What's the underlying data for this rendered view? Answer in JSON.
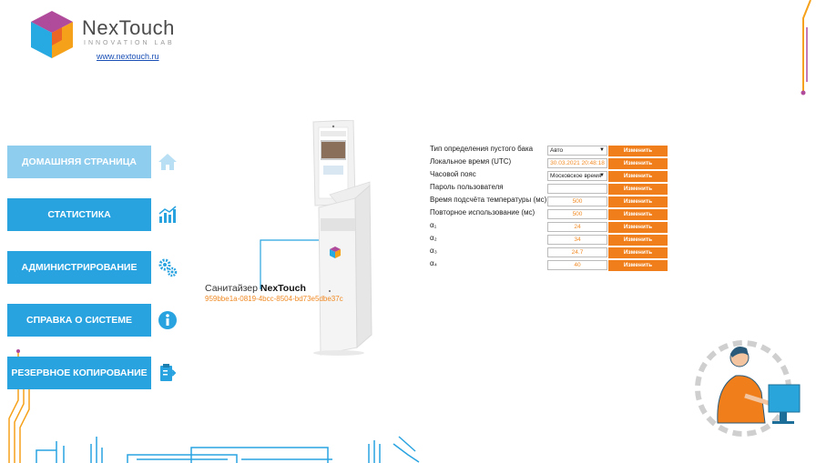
{
  "logo": {
    "brand": "NexTouch",
    "subtitle": "INNOVATION LAB",
    "url": "www.nextouch.ru"
  },
  "nav": {
    "items": [
      {
        "label": "ДОМАШНЯЯ СТРАНИЦА",
        "icon": "home-icon",
        "active": true
      },
      {
        "label": "СТАТИСТИКА",
        "icon": "stats-chart-icon",
        "active": false
      },
      {
        "label": "АДМИНИСТРИРОВАНИЕ",
        "icon": "gears-icon",
        "active": false
      },
      {
        "label": "СПРАВКА О СИСТЕМЕ",
        "icon": "info-icon",
        "active": false
      },
      {
        "label": "РЕЗЕРВНОЕ КОПИРОВАНИЕ",
        "icon": "backup-clipboard-icon",
        "active": false
      }
    ]
  },
  "device": {
    "caption_prefix": "Санитайзер ",
    "caption_brand": "NexTouch",
    "id": "959bbe1a-0819-4bcc-8504-bd73e5dbe37c"
  },
  "settings": {
    "rows": [
      {
        "label": "Тип определения пустого бака",
        "value": "Авто",
        "type": "select",
        "button": "Изменить"
      },
      {
        "label": "Локальное время (UTC)",
        "value": "30.03.2021 20:48:18",
        "type": "text",
        "button": "Изменить"
      },
      {
        "label": "Часовой пояс",
        "value": "Московское время",
        "type": "select",
        "button": "Изменить"
      },
      {
        "label": "Пароль пользователя",
        "value": "",
        "type": "text",
        "button": "Изменить"
      },
      {
        "label": "Время подсчёта температуры (мс)",
        "value": "500",
        "type": "text",
        "button": "Изменить"
      },
      {
        "label": "Повторное использование (мс)",
        "value": "500",
        "type": "text",
        "button": "Изменить"
      },
      {
        "label": "α₁",
        "value": "24",
        "type": "text",
        "button": "Изменить"
      },
      {
        "label": "α₂",
        "value": "34",
        "type": "text",
        "button": "Изменить"
      },
      {
        "label": "α₃",
        "value": "24.7",
        "type": "text",
        "button": "Изменить"
      },
      {
        "label": "α₄",
        "value": "40",
        "type": "text",
        "button": "Изменить"
      }
    ]
  },
  "colors": {
    "nav_blue": "#29a3e0",
    "nav_active": "#8fcdef",
    "accent_orange": "#f07f1b"
  }
}
